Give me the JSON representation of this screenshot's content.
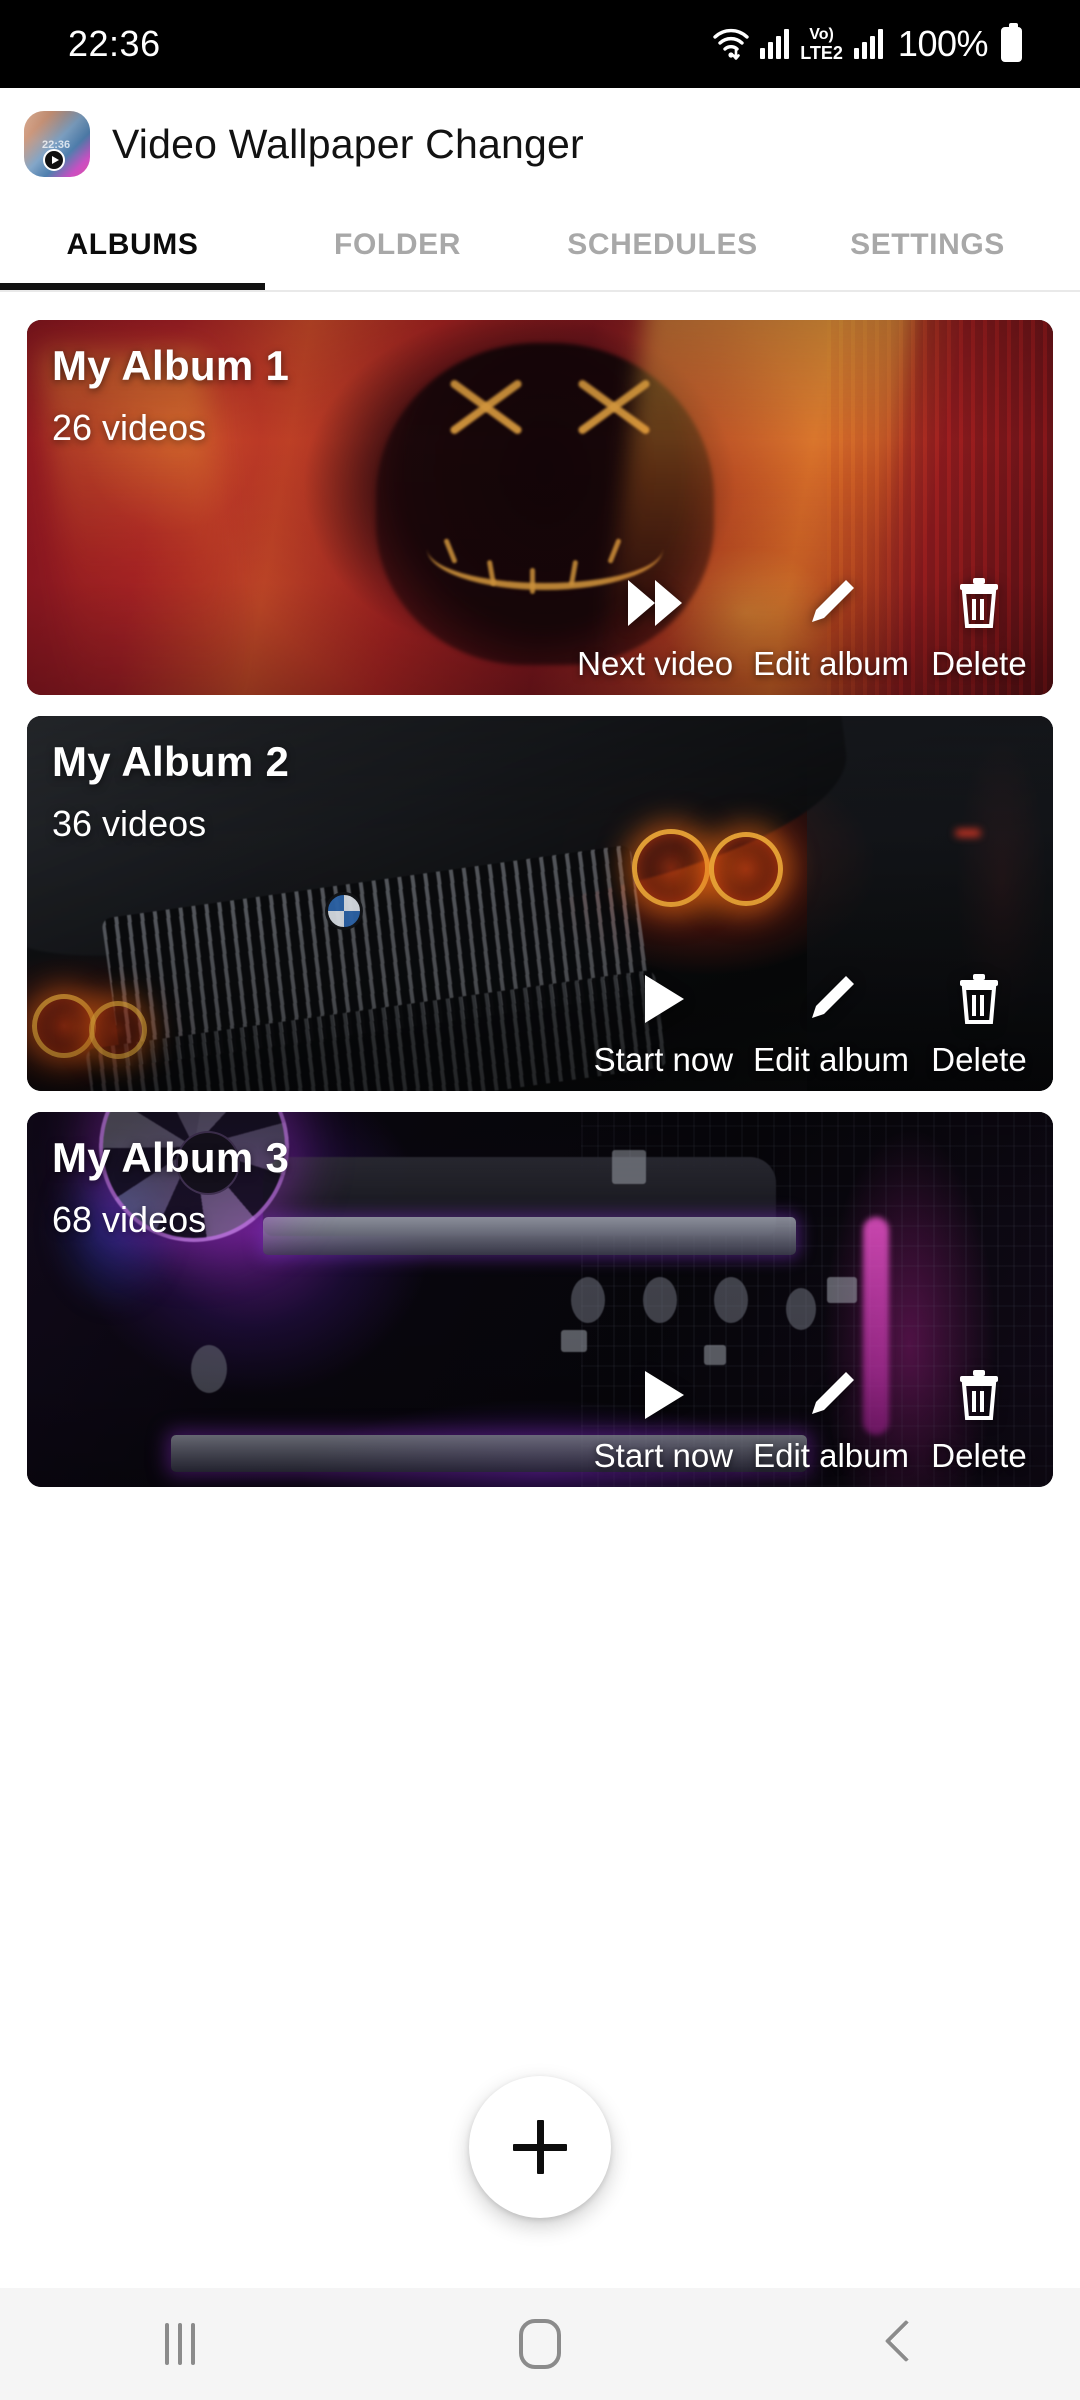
{
  "status_bar": {
    "time": "22:36",
    "network_label_top": "Vo)",
    "network_label_bottom": "LTE2",
    "battery_percent": "100%",
    "icons": [
      "wifi-icon",
      "signal-bars-icon",
      "volte-icon",
      "signal-bars-icon",
      "battery-icon"
    ]
  },
  "app_bar": {
    "title": "Video Wallpaper Changer",
    "icon": "app-logo-icon"
  },
  "tabs": [
    {
      "label": "ALBUMS",
      "active": true
    },
    {
      "label": "FOLDER",
      "active": false
    },
    {
      "label": "SCHEDULES",
      "active": false
    },
    {
      "label": "SETTINGS",
      "active": false
    }
  ],
  "albums": [
    {
      "title": "My Album 1",
      "count": "26 videos",
      "actions": [
        {
          "label": "Next video",
          "icon": "fast-forward-icon"
        },
        {
          "label": "Edit album",
          "icon": "pencil-icon"
        },
        {
          "label": "Delete",
          "icon": "trash-icon"
        }
      ]
    },
    {
      "title": "My Album 2",
      "count": "36 videos",
      "actions": [
        {
          "label": "Start now",
          "icon": "play-icon"
        },
        {
          "label": "Edit album",
          "icon": "pencil-icon"
        },
        {
          "label": "Delete",
          "icon": "trash-icon"
        }
      ]
    },
    {
      "title": "My Album 3",
      "count": "68 videos",
      "actions": [
        {
          "label": "Start now",
          "icon": "play-icon"
        },
        {
          "label": "Edit album",
          "icon": "pencil-icon"
        },
        {
          "label": "Delete",
          "icon": "trash-icon"
        }
      ]
    }
  ],
  "fab": {
    "icon": "plus-icon",
    "label": ""
  },
  "nav_bar": {
    "recents": "recents-icon",
    "home": "home-icon",
    "back": "back-icon"
  },
  "colors": {
    "status_bar_bg": "#000000",
    "app_bar_bg": "#ffffff",
    "tab_active": "#0b0b0b",
    "tab_inactive": "#a8a8a8",
    "nav_bar_bg": "#f5f5f5",
    "fab_bg": "#ffffff"
  }
}
